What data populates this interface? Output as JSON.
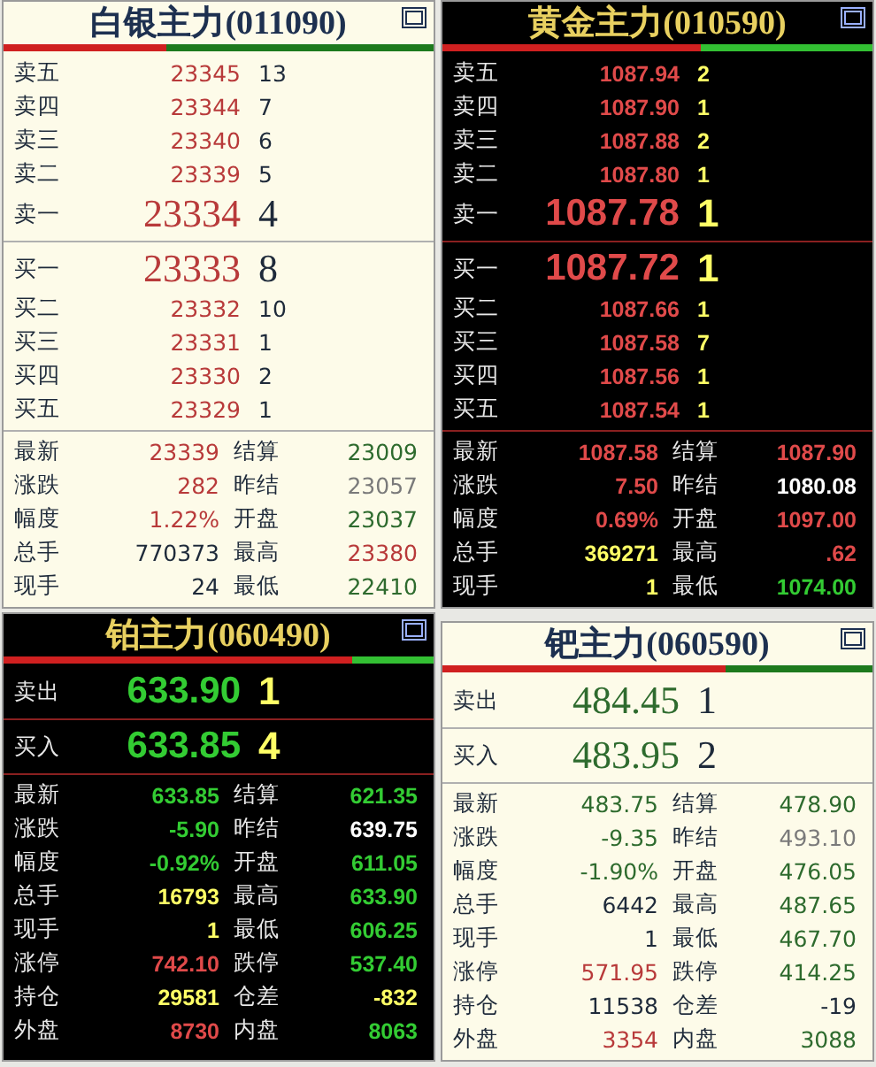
{
  "panels": [
    {
      "title": "白银主力(011090)",
      "kind": "light",
      "level": 0.38,
      "sides": [
        {
          "rows": [
            {
              "kind": "depth",
              "label": "卖五",
              "price": "23345",
              "qty": "13",
              "color": "#b83a3a"
            },
            {
              "kind": "depth",
              "label": "卖四",
              "price": "23344",
              "qty": "7",
              "color": "#b83a3a"
            },
            {
              "kind": "depth",
              "label": "卖三",
              "price": "23340",
              "qty": "6",
              "color": "#b83a3a"
            },
            {
              "kind": "depth",
              "label": "卖二",
              "price": "23339",
              "qty": "5",
              "color": "#b83a3a"
            },
            {
              "kind": "best",
              "label": "卖一",
              "price": "23334",
              "qty": "4",
              "color": "#b83a3a"
            }
          ]
        },
        {
          "rows": [
            {
              "kind": "best",
              "label": "买一",
              "price": "23333",
              "qty": "8",
              "color": "#b83a3a"
            },
            {
              "kind": "depth",
              "label": "买二",
              "price": "23332",
              "qty": "10",
              "color": "#b83a3a"
            },
            {
              "kind": "depth",
              "label": "买三",
              "price": "23331",
              "qty": "1",
              "color": "#b83a3a"
            },
            {
              "kind": "depth",
              "label": "买四",
              "price": "23330",
              "qty": "2",
              "color": "#b83a3a"
            },
            {
              "kind": "depth",
              "label": "买五",
              "price": "23329",
              "qty": "1",
              "color": "#b83a3a"
            }
          ]
        }
      ],
      "stats": [
        {
          "label": "最新",
          "value": "23339",
          "color": "#b83a3a"
        },
        {
          "label": "结算",
          "value": "23009",
          "color": "#2e6b2e"
        },
        {
          "label": "涨跌",
          "value": "282",
          "color": "#b83a3a"
        },
        {
          "label": "昨结",
          "value": "23057",
          "color": "#7a7a7a"
        },
        {
          "label": "幅度",
          "value": "1.22%",
          "color": "#b83a3a"
        },
        {
          "label": "开盘",
          "value": "23037",
          "color": "#2e6b2e"
        },
        {
          "label": "总手",
          "value": "770373",
          "color": "#1e2a3a"
        },
        {
          "label": "最高",
          "value": "23380",
          "color": "#b83a3a"
        },
        {
          "label": "现手",
          "value": "24",
          "color": "#1e2a3a"
        },
        {
          "label": "最低",
          "value": "22410",
          "color": "#2e6b2e"
        }
      ]
    },
    {
      "title": "黄金主力(010590)",
      "kind": "dark",
      "level": 0.6,
      "sides": [
        {
          "rows": [
            {
              "kind": "depth",
              "label": "卖五",
              "price": "1087.94",
              "qty": "2",
              "color": "#e04a4a"
            },
            {
              "kind": "depth",
              "label": "卖四",
              "price": "1087.90",
              "qty": "1",
              "color": "#e04a4a"
            },
            {
              "kind": "depth",
              "label": "卖三",
              "price": "1087.88",
              "qty": "2",
              "color": "#e04a4a"
            },
            {
              "kind": "depth",
              "label": "卖二",
              "price": "1087.80",
              "qty": "1",
              "color": "#e04a4a"
            },
            {
              "kind": "best",
              "label": "卖一",
              "price": "1087.78",
              "qty": "1",
              "color": "#e04a4a"
            }
          ]
        },
        {
          "rows": [
            {
              "kind": "best",
              "label": "买一",
              "price": "1087.72",
              "qty": "1",
              "color": "#e04a4a"
            },
            {
              "kind": "depth",
              "label": "买二",
              "price": "1087.66",
              "qty": "1",
              "color": "#e04a4a"
            },
            {
              "kind": "depth",
              "label": "买三",
              "price": "1087.58",
              "qty": "7",
              "color": "#e04a4a"
            },
            {
              "kind": "depth",
              "label": "买四",
              "price": "1087.56",
              "qty": "1",
              "color": "#e04a4a"
            },
            {
              "kind": "depth",
              "label": "买五",
              "price": "1087.54",
              "qty": "1",
              "color": "#e04a4a"
            }
          ]
        }
      ],
      "stats": [
        {
          "label": "最新",
          "value": "1087.58",
          "color": "#e04a4a"
        },
        {
          "label": "结算",
          "value": "1087.90",
          "color": "#e04a4a"
        },
        {
          "label": "涨跌",
          "value": "7.50",
          "color": "#e04a4a"
        },
        {
          "label": "昨结",
          "value": "1080.08",
          "color": "#ffffff"
        },
        {
          "label": "幅度",
          "value": "0.69%",
          "color": "#e04a4a"
        },
        {
          "label": "开盘",
          "value": "1097.00",
          "color": "#e04a4a"
        },
        {
          "label": "总手",
          "value": "369271",
          "color": "#ffff66"
        },
        {
          "label": "最高",
          "value": ".62",
          "color": "#e04a4a"
        },
        {
          "label": "现手",
          "value": "1",
          "color": "#ffff66"
        },
        {
          "label": "最低",
          "value": "1074.00",
          "color": "#33cc33"
        }
      ]
    },
    {
      "title": "铂主力(060490)",
      "kind": "dark",
      "level": 0.81,
      "sides": [
        {
          "rows": [
            {
              "kind": "best",
              "label": "卖出",
              "price": "633.90",
              "qty": "1",
              "color": "#33cc33"
            }
          ]
        },
        {
          "rows": [
            {
              "kind": "best",
              "label": "买入",
              "price": "633.85",
              "qty": "4",
              "color": "#33cc33"
            }
          ]
        }
      ],
      "stats": [
        {
          "label": "最新",
          "value": "633.85",
          "color": "#33cc33"
        },
        {
          "label": "结算",
          "value": "621.35",
          "color": "#33cc33"
        },
        {
          "label": "涨跌",
          "value": "-5.90",
          "color": "#33cc33"
        },
        {
          "label": "昨结",
          "value": "639.75",
          "color": "#ffffff"
        },
        {
          "label": "幅度",
          "value": "-0.92%",
          "color": "#33cc33"
        },
        {
          "label": "开盘",
          "value": "611.05",
          "color": "#33cc33"
        },
        {
          "label": "总手",
          "value": "16793",
          "color": "#ffff66"
        },
        {
          "label": "最高",
          "value": "633.90",
          "color": "#33cc33"
        },
        {
          "label": "现手",
          "value": "1",
          "color": "#ffff66"
        },
        {
          "label": "最低",
          "value": "606.25",
          "color": "#33cc33"
        },
        {
          "label": "涨停",
          "value": "742.10",
          "color": "#e04a4a"
        },
        {
          "label": "跌停",
          "value": "537.40",
          "color": "#33cc33"
        },
        {
          "label": "持仓",
          "value": "29581",
          "color": "#ffff66"
        },
        {
          "label": "仓差",
          "value": "-832",
          "color": "#ffff66"
        },
        {
          "label": "外盘",
          "value": "8730",
          "color": "#e04a4a"
        },
        {
          "label": "内盘",
          "value": "8063",
          "color": "#33cc33"
        }
      ]
    },
    {
      "title": "钯主力(060590)",
      "kind": "light",
      "level": 0.66,
      "sides": [
        {
          "rows": [
            {
              "kind": "best",
              "label": "卖出",
              "price": "484.45",
              "qty": "1",
              "color": "#2e6b2e"
            }
          ]
        },
        {
          "rows": [
            {
              "kind": "best",
              "label": "买入",
              "price": "483.95",
              "qty": "2",
              "color": "#2e6b2e"
            }
          ]
        }
      ],
      "stats": [
        {
          "label": "最新",
          "value": "483.75",
          "color": "#2e6b2e"
        },
        {
          "label": "结算",
          "value": "478.90",
          "color": "#2e6b2e"
        },
        {
          "label": "涨跌",
          "value": "-9.35",
          "color": "#2e6b2e"
        },
        {
          "label": "昨结",
          "value": "493.10",
          "color": "#7a7a7a"
        },
        {
          "label": "幅度",
          "value": "-1.90%",
          "color": "#2e6b2e"
        },
        {
          "label": "开盘",
          "value": "476.05",
          "color": "#2e6b2e"
        },
        {
          "label": "总手",
          "value": "6442",
          "color": "#1e2a3a"
        },
        {
          "label": "最高",
          "value": "487.65",
          "color": "#2e6b2e"
        },
        {
          "label": "现手",
          "value": "1",
          "color": "#1e2a3a"
        },
        {
          "label": "最低",
          "value": "467.70",
          "color": "#2e6b2e"
        },
        {
          "label": "涨停",
          "value": "571.95",
          "color": "#b83a3a"
        },
        {
          "label": "跌停",
          "value": "414.25",
          "color": "#2e6b2e"
        },
        {
          "label": "持仓",
          "value": "11538",
          "color": "#1e2a3a"
        },
        {
          "label": "仓差",
          "value": "-19",
          "color": "#1e2a3a"
        },
        {
          "label": "外盘",
          "value": "3354",
          "color": "#b83a3a"
        },
        {
          "label": "内盘",
          "value": "3088",
          "color": "#2e6b2e"
        }
      ]
    }
  ]
}
